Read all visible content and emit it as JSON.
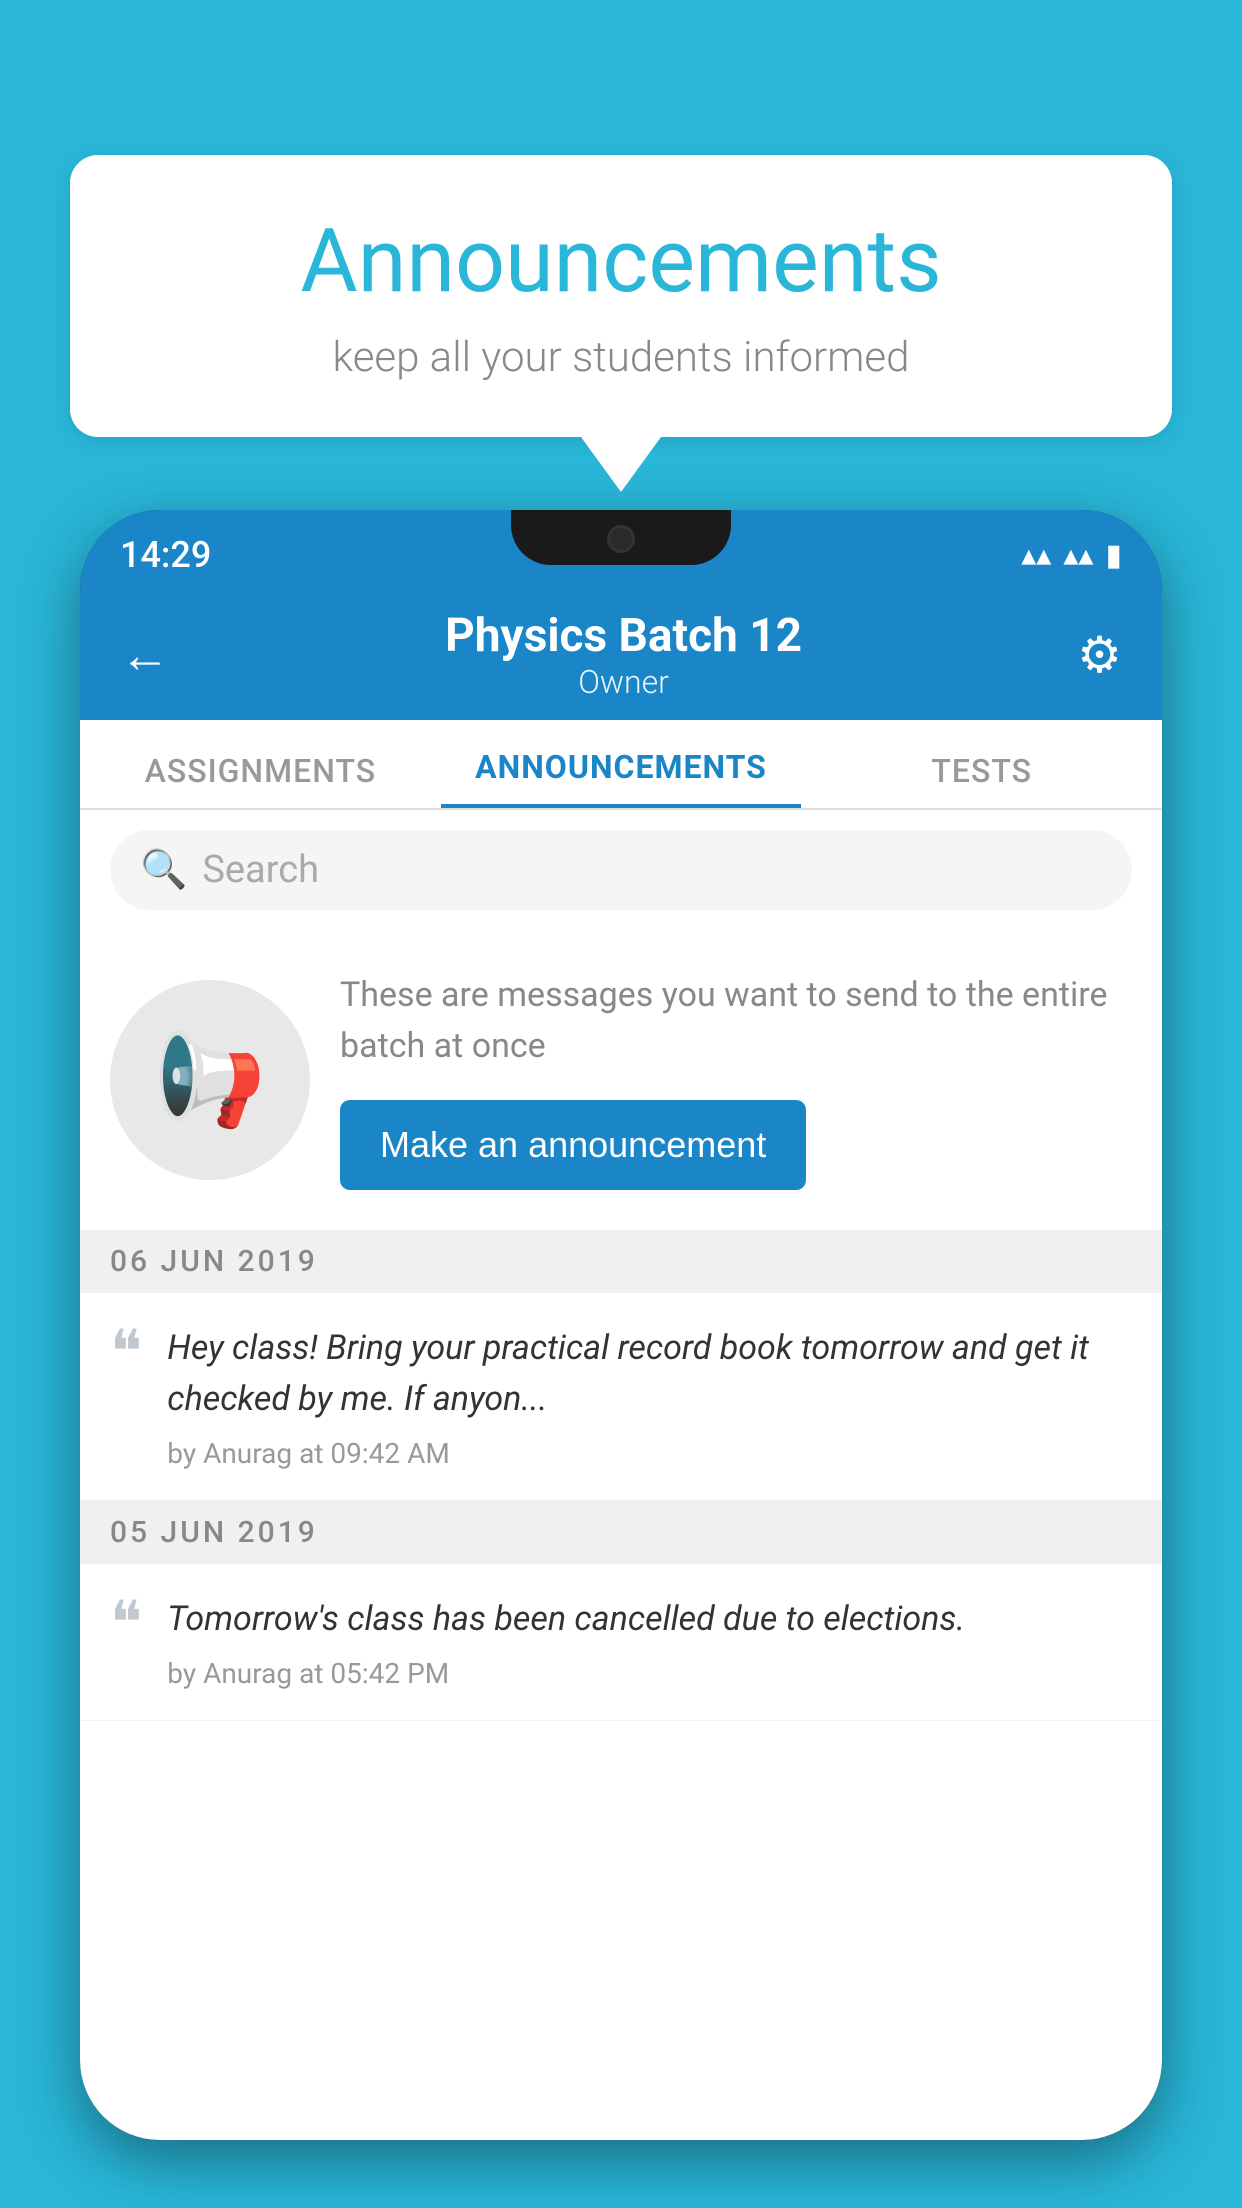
{
  "background_color": "#29b6d8",
  "speech_bubble": {
    "title": "Announcements",
    "subtitle": "keep all your students informed"
  },
  "status_bar": {
    "time": "14:29",
    "wifi": "▾",
    "signal": "▾",
    "battery": "▮"
  },
  "header": {
    "title": "Physics Batch 12",
    "subtitle": "Owner",
    "back_label": "←",
    "gear_label": "⚙"
  },
  "tabs": [
    {
      "label": "ASSIGNMENTS",
      "active": false
    },
    {
      "label": "ANNOUNCEMENTS",
      "active": true
    },
    {
      "label": "TESTS",
      "active": false
    }
  ],
  "search": {
    "placeholder": "Search"
  },
  "promo": {
    "description": "These are messages you want to send to the entire batch at once",
    "button_label": "Make an announcement"
  },
  "announcements": [
    {
      "date": "06  JUN  2019",
      "text": "Hey class! Bring your practical record book tomorrow and get it checked by me. If anyon...",
      "meta": "by Anurag at 09:42 AM"
    },
    {
      "date": "05  JUN  2019",
      "text": "Tomorrow's class has been cancelled due to elections.",
      "meta": "by Anurag at 05:42 PM"
    }
  ]
}
